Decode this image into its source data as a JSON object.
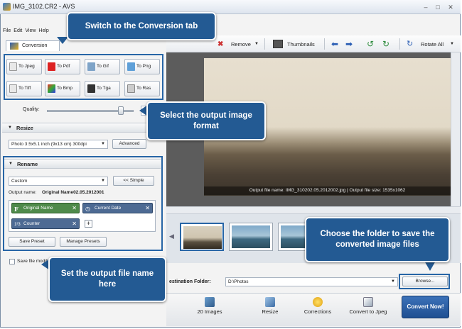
{
  "window": {
    "title": "IMG_3102.CR2 - AVS"
  },
  "menu": [
    "File",
    "Edit",
    "View",
    "Help"
  ],
  "tab": {
    "label": "Conversion"
  },
  "toolbar": {
    "remove": "Remove",
    "thumbnails": "Thumbnails",
    "rotate_all": "Rotate All"
  },
  "formats": [
    "To Jpeg",
    "To Pdf",
    "To Gif",
    "To Png",
    "To Tiff",
    "To Bmp",
    "To Tga",
    "To Ras"
  ],
  "quality": {
    "label": "Quality:"
  },
  "resize": {
    "title": "Resize",
    "preset": "Photo 3.5x5.1 inch (9x13 cm) 300dpi",
    "advanced": "Advanced"
  },
  "rename": {
    "title": "Rename",
    "mode": "Custom",
    "simple": "<< Simple",
    "output_label": "Output name:",
    "output_value": "Original Name02.05.2012001",
    "tags": [
      "Original Name",
      "Current Date",
      "Counter"
    ],
    "save_preset": "Save Preset",
    "manage_presets": "Manage Presets"
  },
  "save_modified": "Save file modif",
  "preview": {
    "caption": "Output file name: IMG_310202.05.2012002.jpg | Output file size: 1535x1062"
  },
  "destination": {
    "label": "estination Folder:",
    "value": "D:\\Photos",
    "browse": "Browse..."
  },
  "steps": [
    "20 Images",
    "Resize",
    "Corrections",
    "Convert to Jpeg"
  ],
  "convert_button": "Convert Now!",
  "callouts": {
    "tab": "Switch to the Conversion tab",
    "format": "Select the output image format",
    "folder": "Choose the folder to save the converted image files",
    "name": "Set the output file name here"
  },
  "colors": {
    "callout": "#235a93",
    "accent": "#2765a6"
  }
}
